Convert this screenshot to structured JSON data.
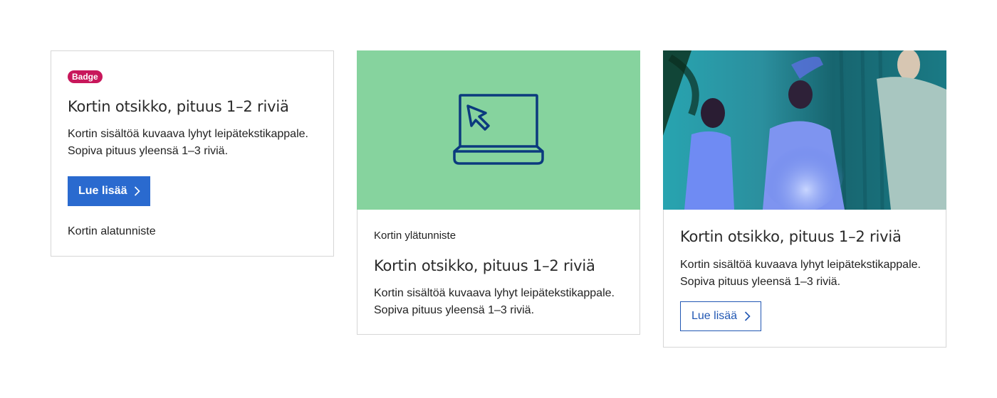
{
  "cards": [
    {
      "badge": "Badge",
      "title": "Kortin otsikko, pituus 1–2 riviä",
      "body": "Kortin sisältöä kuvaava lyhyt leipätekstikappale. Sopiva pituus yleensä 1–3 riviä.",
      "button_label": "Lue lisää",
      "footer": "Kortin alatunniste"
    },
    {
      "media_icon": "laptop-cursor-icon",
      "overline": "Kortin ylätunniste",
      "title": "Kortin otsikko, pituus 1–2 riviä",
      "body": "Kortin sisältöä kuvaava lyhyt leipätekstikappale. Sopiva pituus yleensä 1–3 riviä."
    },
    {
      "media_image": "dancing-people-photo",
      "title": "Kortin otsikko, pituus 1–2 riviä",
      "body": "Kortin sisältöä kuvaava lyhyt leipätekstikappale. Sopiva pituus yleensä 1–3 riviä.",
      "button_label": "Lue lisää"
    }
  ],
  "colors": {
    "badge": "#c8175b",
    "primary_button": "#2a6acf",
    "secondary_button_border": "#2157b3",
    "media_green": "#86d39e",
    "icon_navy": "#0b3a7e",
    "card_border": "#d6d6d6"
  }
}
